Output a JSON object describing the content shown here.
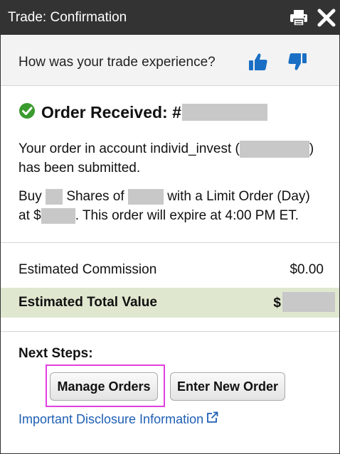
{
  "window": {
    "title": "Trade: Confirmation",
    "icons": {
      "print": "print-icon",
      "close": "close-icon"
    }
  },
  "feedback": {
    "question": "How was your trade experience?",
    "icons": {
      "up": "thumbs-up-icon",
      "down": "thumbs-down-icon"
    },
    "color": "#1a6fc4"
  },
  "confirmation": {
    "heading": "Order Received: #",
    "status_icon": "check-circle-icon",
    "status_color": "#3a9b2e",
    "line1_pre": "Your order in account individ_invest (",
    "line1_post": ")",
    "line1_cont": "has been submitted.",
    "line2_a": "Buy",
    "line2_b": "Shares of",
    "line2_c": "with a Limit Order (Day)",
    "line2_d": "at $",
    "line2_e": ". This order will expire at 4:00 PM ET."
  },
  "summary": {
    "commission_label": "Estimated Commission",
    "commission_value": "$0.00",
    "total_label": "Estimated Total Value",
    "total_value_prefix": "$",
    "total_bg": "#dfe8cf"
  },
  "next_steps": {
    "label": "Next Steps:",
    "manage_orders": "Manage Orders",
    "enter_new_order": "Enter New Order"
  },
  "disclosure": {
    "link": "Important Disclosure Information",
    "icon": "external-link-icon",
    "color": "#1f5fb4"
  }
}
